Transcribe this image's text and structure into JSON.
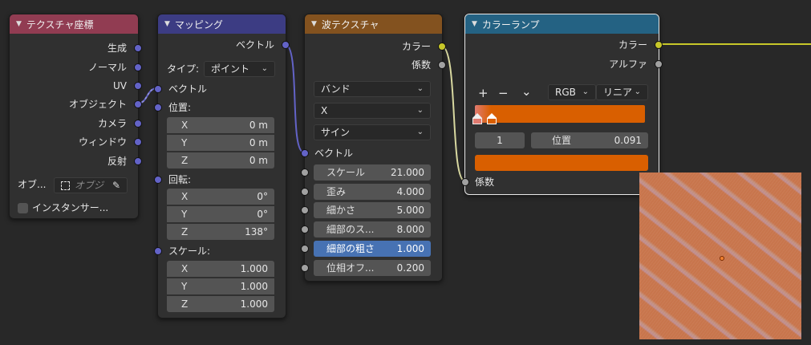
{
  "colors": {
    "texcoord_header": "#913c52",
    "mapping_header": "#3c3c83",
    "wave_header": "#83521f",
    "ramp_header": "#246283",
    "vector_socket": "#6363c7",
    "color_socket": "#c7c729",
    "float_socket": "#a1a1a1",
    "ramp_color": "#d95f00",
    "selected_field": "#4772b3"
  },
  "texcoord": {
    "title": "テクスチャ座標",
    "outputs": [
      "生成",
      "ノーマル",
      "UV",
      "オブジェクト",
      "カメラ",
      "ウィンドウ",
      "反射"
    ],
    "object_label": "オブ...",
    "object_placeholder": "オブジ",
    "object_icon": "object-icon",
    "eyedropper_icon": "eyedropper-icon",
    "instancer_label": "インスタンサー..."
  },
  "mapping": {
    "title": "マッピング",
    "output": "ベクトル",
    "type_label": "タイプ:",
    "type_value": "ポイント",
    "vector_input": "ベクトル",
    "location_label": "位置:",
    "location": [
      {
        "axis": "X",
        "value": "0 m"
      },
      {
        "axis": "Y",
        "value": "0 m"
      },
      {
        "axis": "Z",
        "value": "0 m"
      }
    ],
    "rotation_label": "回転:",
    "rotation": [
      {
        "axis": "X",
        "value": "0°"
      },
      {
        "axis": "Y",
        "value": "0°"
      },
      {
        "axis": "Z",
        "value": "138°"
      }
    ],
    "scale_label": "スケール:",
    "scale": [
      {
        "axis": "X",
        "value": "1.000"
      },
      {
        "axis": "Y",
        "value": "1.000"
      },
      {
        "axis": "Z",
        "value": "1.000"
      }
    ]
  },
  "wave": {
    "title": "波テクスチャ",
    "out_color": "カラー",
    "out_fac": "係数",
    "type": "バンド",
    "direction": "X",
    "profile": "サイン",
    "vector_input": "ベクトル",
    "fields": [
      {
        "label": "スケール",
        "value": "21.000"
      },
      {
        "label": "歪み",
        "value": "4.000"
      },
      {
        "label": "細かさ",
        "value": "5.000"
      },
      {
        "label": "細部のス...",
        "value": "8.000"
      },
      {
        "label": "細部の粗さ",
        "value": "1.000"
      },
      {
        "label": "位相オフ...",
        "value": "0.200"
      }
    ]
  },
  "ramp": {
    "title": "カラーランプ",
    "out_color": "カラー",
    "out_alpha": "アルファ",
    "add": "+",
    "remove": "−",
    "menu": "⌄",
    "color_mode": "RGB",
    "interpolation": "リニア",
    "stop_index": "1",
    "pos_label": "位置",
    "pos_value": "0.091",
    "fac_input": "係数"
  }
}
